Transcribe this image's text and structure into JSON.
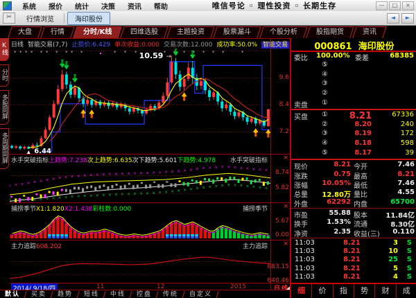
{
  "titlebar": {
    "menus": [
      "系统",
      "报价",
      "统计",
      "决策",
      "资讯",
      "帮助"
    ],
    "slogan": "唯信号论  ◦  理性投资  ◦  长期生存"
  },
  "icons": {
    "minimize": "—",
    "maximize": "□",
    "close": "×",
    "back": "◄",
    "forward": "►",
    "tool": "✂",
    "panel_close": "×",
    "star": "*",
    "arrow_right": "→"
  },
  "navbar": {
    "browse": "行情浏览",
    "stock_tab": "海印股份"
  },
  "main_tabs": [
    "大盘",
    "行情",
    "分时/K线",
    "四维选股",
    "主题投资",
    "股票漏斗",
    "个股分析",
    "股指期货",
    "资讯"
  ],
  "main_tabs_active": 2,
  "sidebar": [
    "K线",
    "分时",
    "多股同屏",
    "多周期同屏"
  ],
  "sidebar_active": 0,
  "chart": {
    "header": [
      {
        "text": "日线",
        "color": "#c8c8c8"
      },
      {
        "text": "智能交易(7,7)",
        "color": "#c8c8c8"
      },
      {
        "text": "止损价:6.429",
        "color": "#4a5cff"
      },
      {
        "text": "单次收益:0.000",
        "color": "#ff2222"
      },
      {
        "text": "交易次数:12.000",
        "color": "#999999"
      },
      {
        "text": "成功率:50.0%",
        "color": "#ffff00"
      },
      {
        "text": "智能交易",
        "color": "#ffee44",
        "chip": true
      }
    ],
    "high_label": "10.59",
    "low_label": "6.44",
    "price_min": 6.2,
    "price_max": 10.9,
    "grid_values": [
      10.8,
      9.6,
      8.4,
      7.2
    ],
    "y_ticks": [
      {
        "v": 9.6,
        "label": "9.6"
      },
      {
        "v": 8.4,
        "label": "8.4"
      },
      {
        "v": 7.2,
        "label": "7.2"
      }
    ],
    "x_ticks": [
      {
        "label": "2014/ 9/18/四",
        "x": 2,
        "highlight": true
      },
      {
        "label": "11",
        "x": 125,
        "highlight": false
      },
      {
        "label": "12",
        "x": 212,
        "highlight": false
      },
      {
        "label": "2015",
        "x": 318,
        "highlight": false
      }
    ],
    "period_label": "日线",
    "up_color": "#ff3a3a",
    "down_color": "#00e0e0",
    "ma_fast_color": "#ffff00",
    "ma_slow_color": "#cc2222",
    "stop_line_color": "#1e3cff",
    "candles": [
      [
        6.58,
        6.5,
        6.44,
        6.64
      ],
      [
        6.5,
        6.56,
        6.45,
        6.62
      ],
      [
        6.56,
        6.47,
        6.4,
        6.6
      ],
      [
        6.47,
        6.54,
        6.42,
        6.6
      ],
      [
        6.54,
        6.46,
        6.44,
        6.58
      ],
      [
        6.46,
        6.62,
        6.44,
        6.7
      ],
      [
        6.62,
        6.58,
        6.5,
        6.74
      ],
      [
        6.58,
        6.92,
        6.54,
        7.02
      ],
      [
        6.92,
        7.3,
        6.88,
        7.42
      ],
      [
        7.3,
        7.85,
        7.24,
        7.95
      ],
      [
        7.85,
        8.45,
        7.8,
        8.6
      ],
      [
        8.45,
        9.1,
        8.38,
        9.28
      ],
      [
        9.1,
        9.75,
        9.0,
        9.95
      ],
      [
        9.75,
        9.3,
        9.12,
        9.88
      ],
      [
        9.3,
        8.85,
        8.7,
        9.45
      ],
      [
        8.85,
        9.15,
        8.72,
        9.3
      ],
      [
        9.15,
        8.7,
        8.55,
        9.22
      ],
      [
        8.7,
        8.45,
        8.3,
        8.8
      ],
      [
        8.45,
        8.62,
        8.35,
        8.75
      ],
      [
        8.62,
        8.4,
        8.28,
        8.7
      ],
      [
        8.4,
        8.55,
        8.32,
        8.66
      ],
      [
        8.55,
        8.38,
        8.25,
        8.62
      ],
      [
        8.38,
        8.5,
        8.3,
        8.6
      ],
      [
        8.5,
        8.35,
        8.22,
        8.58
      ],
      [
        8.35,
        8.48,
        8.28,
        8.56
      ],
      [
        8.48,
        8.3,
        8.18,
        8.54
      ],
      [
        8.3,
        8.42,
        8.22,
        8.52
      ],
      [
        8.42,
        8.25,
        8.12,
        8.48
      ],
      [
        8.25,
        8.1,
        7.98,
        8.35
      ],
      [
        8.1,
        8.25,
        8.02,
        8.36
      ],
      [
        8.25,
        8.15,
        8.02,
        8.32
      ],
      [
        8.15,
        8.02,
        7.9,
        8.24
      ],
      [
        8.02,
        8.2,
        7.95,
        8.3
      ],
      [
        8.2,
        8.35,
        8.1,
        8.45
      ],
      [
        8.35,
        8.25,
        8.12,
        8.44
      ],
      [
        8.25,
        8.5,
        8.18,
        8.6
      ],
      [
        8.5,
        8.8,
        8.42,
        8.95
      ],
      [
        8.8,
        9.4,
        8.72,
        9.6
      ],
      [
        9.4,
        10.3,
        9.32,
        10.59
      ],
      [
        10.3,
        9.75,
        9.55,
        10.48
      ],
      [
        9.75,
        9.2,
        9.02,
        9.92
      ],
      [
        9.2,
        9.55,
        9.05,
        9.7
      ],
      [
        9.55,
        10.05,
        9.45,
        10.28
      ],
      [
        10.05,
        9.6,
        9.35,
        10.35
      ],
      [
        9.6,
        9.25,
        9.05,
        9.78
      ],
      [
        9.25,
        9.45,
        9.1,
        9.62
      ],
      [
        9.45,
        9.05,
        8.88,
        9.55
      ],
      [
        9.05,
        8.75,
        8.58,
        9.15
      ],
      [
        8.75,
        8.95,
        8.62,
        9.08
      ],
      [
        8.95,
        8.55,
        8.4,
        9.02
      ],
      [
        8.55,
        8.25,
        8.1,
        8.66
      ],
      [
        8.25,
        8.42,
        8.15,
        8.55
      ],
      [
        8.42,
        8.1,
        7.95,
        8.5
      ],
      [
        8.1,
        7.9,
        7.76,
        8.2
      ],
      [
        7.9,
        8.08,
        7.82,
        8.18
      ],
      [
        8.08,
        7.85,
        7.7,
        8.15
      ],
      [
        7.85,
        7.65,
        7.52,
        7.95
      ],
      [
        7.65,
        7.8,
        7.56,
        7.92
      ],
      [
        7.8,
        7.58,
        7.46,
        7.88
      ],
      [
        7.58,
        7.7,
        7.48,
        7.8
      ],
      [
        7.7,
        7.48,
        7.4,
        7.76
      ],
      [
        7.46,
        8.21,
        7.42,
        8.21
      ]
    ],
    "stop_steps": [
      [
        0,
        5.95
      ],
      [
        8,
        6.35
      ],
      [
        10,
        7.2
      ],
      [
        12,
        8.45
      ],
      [
        18,
        7.55
      ],
      [
        31,
        7.55
      ],
      [
        32,
        8.6
      ],
      [
        37,
        8.6
      ],
      [
        38,
        10.32
      ],
      [
        43,
        10.32
      ],
      [
        44,
        8.92
      ],
      [
        46,
        10.15
      ],
      [
        60,
        10.15
      ],
      [
        60,
        7.3
      ],
      [
        62,
        7.3
      ]
    ],
    "sell_signals": [
      12,
      13,
      15,
      39,
      43
    ],
    "buy_signals": [
      17,
      19,
      41,
      58,
      61
    ]
  },
  "ind1": {
    "title": "水手突破指标",
    "values": [
      {
        "text": "上趋势:7.238",
        "color": "#ff00ff"
      },
      {
        "text": "次上趋势:6.635",
        "color": "#ffff00"
      },
      {
        "text": "次下趋势:5.601",
        "color": "#e8e8e8"
      },
      {
        "text": "下趋势:4.978",
        "color": "#00ff00"
      }
    ],
    "right_title": "水手突破指标",
    "axis": [
      "8.74",
      "5.82"
    ]
  },
  "ind2": {
    "title": "捕捞季节",
    "values": [
      {
        "text": "X1:1.820",
        "color": "#ffff00"
      },
      {
        "text": "X2:1.438",
        "color": "#ff00ff"
      },
      {
        "text": "彩柱数:0.000",
        "color": "#00ff00"
      }
    ],
    "right_title": "捕捞季节",
    "axis": [
      "5.67",
      "0.00"
    ],
    "bars": [
      0.18,
      0.24,
      0.3,
      0.26,
      0.18,
      0.14,
      0.2,
      0.3,
      0.45,
      0.62,
      0.85,
      1.0,
      0.92,
      0.7,
      0.5,
      0.35,
      0.25,
      0.2,
      0.25,
      0.3,
      0.28,
      0.33,
      0.38,
      0.33,
      0.26,
      0.18,
      0.13,
      0.1,
      0.12,
      0.16,
      0.13,
      0.1,
      0.13,
      0.18,
      0.24,
      0.3,
      0.42,
      0.58,
      0.72,
      0.78,
      0.7,
      0.6,
      0.66,
      0.72,
      0.62,
      0.5,
      0.4,
      0.3,
      -0.3,
      -0.45,
      -0.55,
      -0.5,
      -0.42,
      -0.34,
      -0.28,
      -0.22,
      -0.18,
      -0.14,
      -0.18,
      -0.22,
      -0.18,
      -0.15
    ]
  },
  "ind3": {
    "title": "主力追踪",
    "value": "608.202",
    "right_title": "主力追踪",
    "axis": [
      "683.15",
      "640.46"
    ],
    "line": [
      [
        0,
        0.92
      ],
      [
        0.04,
        0.88
      ],
      [
        0.08,
        0.8
      ],
      [
        0.12,
        0.7
      ],
      [
        0.16,
        0.58
      ],
      [
        0.2,
        0.47
      ],
      [
        0.24,
        0.42
      ],
      [
        0.28,
        0.4
      ],
      [
        0.34,
        0.41
      ],
      [
        0.4,
        0.42
      ],
      [
        0.46,
        0.44
      ],
      [
        0.5,
        0.43
      ],
      [
        0.54,
        0.41
      ],
      [
        0.58,
        0.36
      ],
      [
        0.62,
        0.3
      ],
      [
        0.66,
        0.25
      ],
      [
        0.7,
        0.21
      ],
      [
        0.73,
        0.18
      ],
      [
        0.76,
        0.17
      ],
      [
        0.8,
        0.22
      ],
      [
        0.85,
        0.28
      ],
      [
        0.9,
        0.33
      ],
      [
        0.95,
        0.37
      ],
      [
        1,
        0.4
      ]
    ]
  },
  "bottom_tabs": [
    "默认",
    "买卖",
    "趋势",
    "短线",
    "中线",
    "控盘",
    "传统",
    "自定义"
  ],
  "bottom_tabs_active": 0,
  "panel": {
    "code": "000861",
    "name": "海印股份",
    "weibi_label": "委比",
    "weibi": "100.00%",
    "weicha_label": "委差",
    "weicha": "68385",
    "sell_label": "卖盘",
    "buy_label": "买盘",
    "ask_nums": [
      "⑤",
      "④",
      "③",
      "②",
      "①"
    ],
    "bids": [
      {
        "n": "①",
        "p": "8.21",
        "v": "67336",
        "big": true
      },
      {
        "n": "②",
        "p": "8.20",
        "v": "240",
        "big": false
      },
      {
        "n": "③",
        "p": "8.19",
        "v": "172",
        "big": false
      },
      {
        "n": "④",
        "p": "8.18",
        "v": "598",
        "big": false
      },
      {
        "n": "⑤",
        "p": "8.17",
        "v": "39",
        "big": false
      }
    ],
    "stats_a": [
      {
        "l": "现价",
        "v": "8.21",
        "c": "#ff3333",
        "l2": "今开",
        "v2": "7.46",
        "c2": "#e8e8e8"
      },
      {
        "l": "涨跌",
        "v": "0.75",
        "c": "#ff3333",
        "l2": "最高",
        "v2": "8.21",
        "c2": "#ff3333"
      },
      {
        "l": "涨幅",
        "v": "10.05%",
        "c": "#ff3333",
        "l2": "最低",
        "v2": "7.46",
        "c2": "#e8e8e8"
      },
      {
        "l": "总量",
        "v": "12.80万",
        "c": "#ffff00",
        "l2": "量比",
        "v2": "4.55",
        "c2": "#e8e8e8"
      },
      {
        "l": "外盘",
        "v": "62292",
        "c": "#ff3333",
        "l2": "内盘",
        "v2": "65700",
        "c2": "#00ee44"
      }
    ],
    "stats_b": [
      {
        "l": "市盈",
        "v": "55.88",
        "c": "#e8e8e8",
        "l2": "股本",
        "v2": "11.84亿",
        "c2": "#e8e8e8"
      },
      {
        "l": "换手",
        "v": "1.53%",
        "c": "#e8e8e8",
        "l2": "流通",
        "v2": "8.30亿",
        "c2": "#e8e8e8"
      },
      {
        "l": "净资",
        "v": "2.35",
        "c": "#e8e8e8",
        "l2": "收益(三)",
        "v2": "0.110",
        "c2": "#e8e8e8"
      }
    ],
    "ticks": [
      {
        "t": "11:03",
        "p": "8.21",
        "v": "3",
        "vc": "#ffff00",
        "d": "S"
      },
      {
        "t": "11:03",
        "p": "8.21",
        "v": "10",
        "vc": "#ffff00",
        "d": "S"
      },
      {
        "t": "11:03",
        "p": "8.21",
        "v": "25",
        "vc": "#00ee44",
        "d": "S"
      },
      {
        "t": "11:03",
        "p": "8.21",
        "v": "5",
        "vc": "#ffff00",
        "d": "S"
      },
      {
        "t": "11:03",
        "p": "8.21",
        "v": "4",
        "vc": "#ffff00",
        "d": "S"
      }
    ],
    "tabs": [
      "细",
      "价",
      "指",
      "势",
      "财",
      "成"
    ],
    "tabs_active": 0
  }
}
